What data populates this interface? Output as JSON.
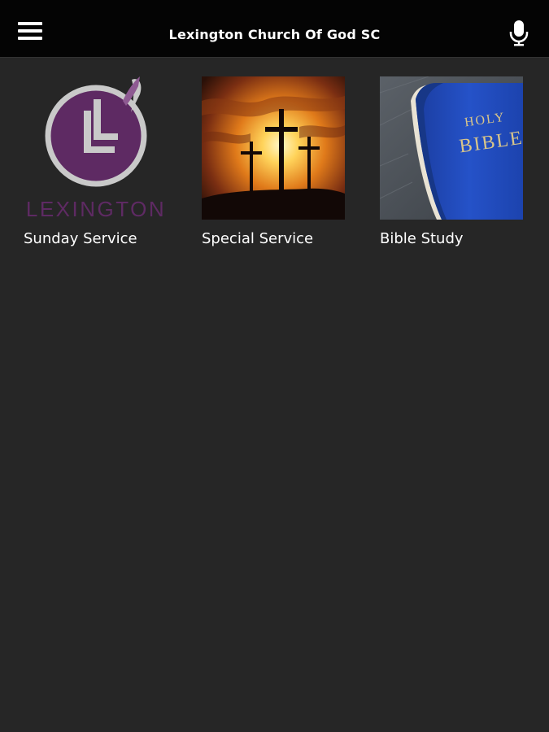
{
  "app": {
    "title": "Lexington Church Of God SC"
  },
  "icons": {
    "menu": "hamburger-menu-icon",
    "voice": "microphone-icon"
  },
  "tiles": [
    {
      "label": "Sunday Service",
      "image": "lexington-logo",
      "logo_text": "LEXINGTON"
    },
    {
      "label": "Special Service",
      "image": "three-crosses-sunset"
    },
    {
      "label": "Bible Study",
      "image": "holy-bible-book",
      "book_text_1": "HOLY",
      "book_text_2": "BIBLE"
    }
  ],
  "colors": {
    "topbar": "#040404",
    "background": "#262626",
    "logo_purple": "#5e2a63"
  }
}
